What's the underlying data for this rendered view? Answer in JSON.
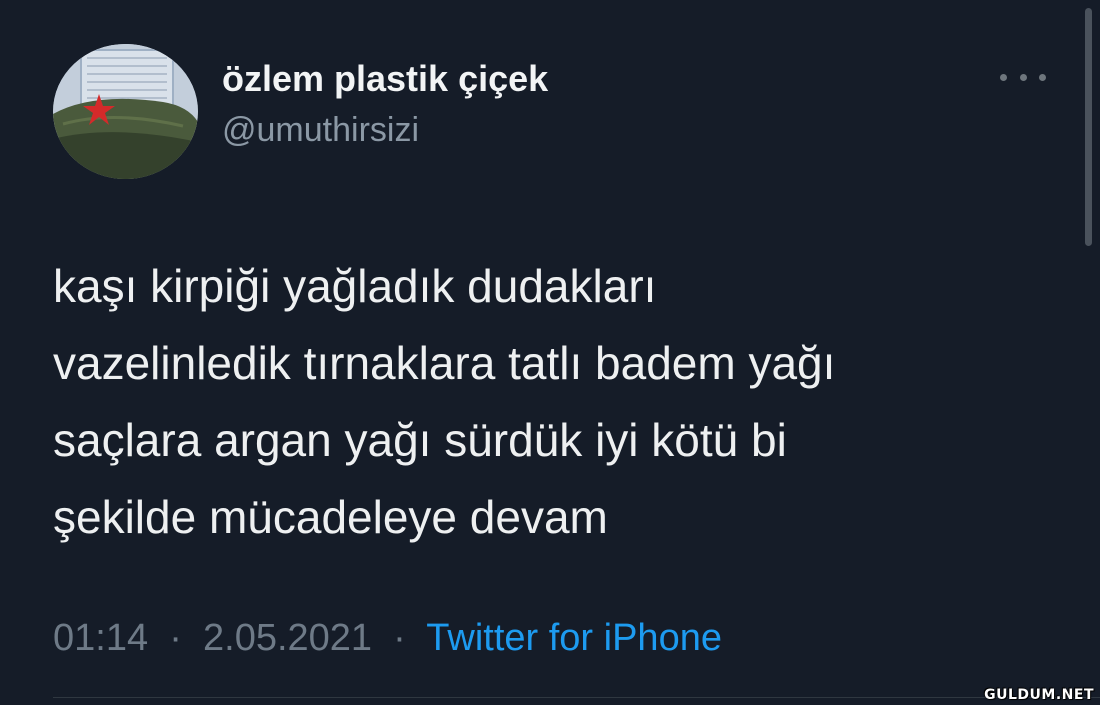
{
  "author": {
    "display_name": "özlem plastik çiçek",
    "handle": "@umuthirsizi",
    "avatar_icon": "avatar-green-cap-red-star"
  },
  "actions": {
    "more_icon": "ellipsis-icon"
  },
  "tweet": {
    "lines": [
      "kaşı kirpiği yağladık dudakları",
      "vazelinledik tırnaklara tatlı badem yağı",
      "saçlara argan yağı sürdük iyi kötü bi",
      "şekilde mücadeleye devam"
    ]
  },
  "meta": {
    "time": "01:14",
    "separator": "·",
    "date": "2.05.2021",
    "source": "Twitter for iPhone"
  },
  "watermark": "GULDUM.NET",
  "colors": {
    "background": "#151c28",
    "accent": "#1d9bf0",
    "secondary_text": "#8b98a5"
  }
}
